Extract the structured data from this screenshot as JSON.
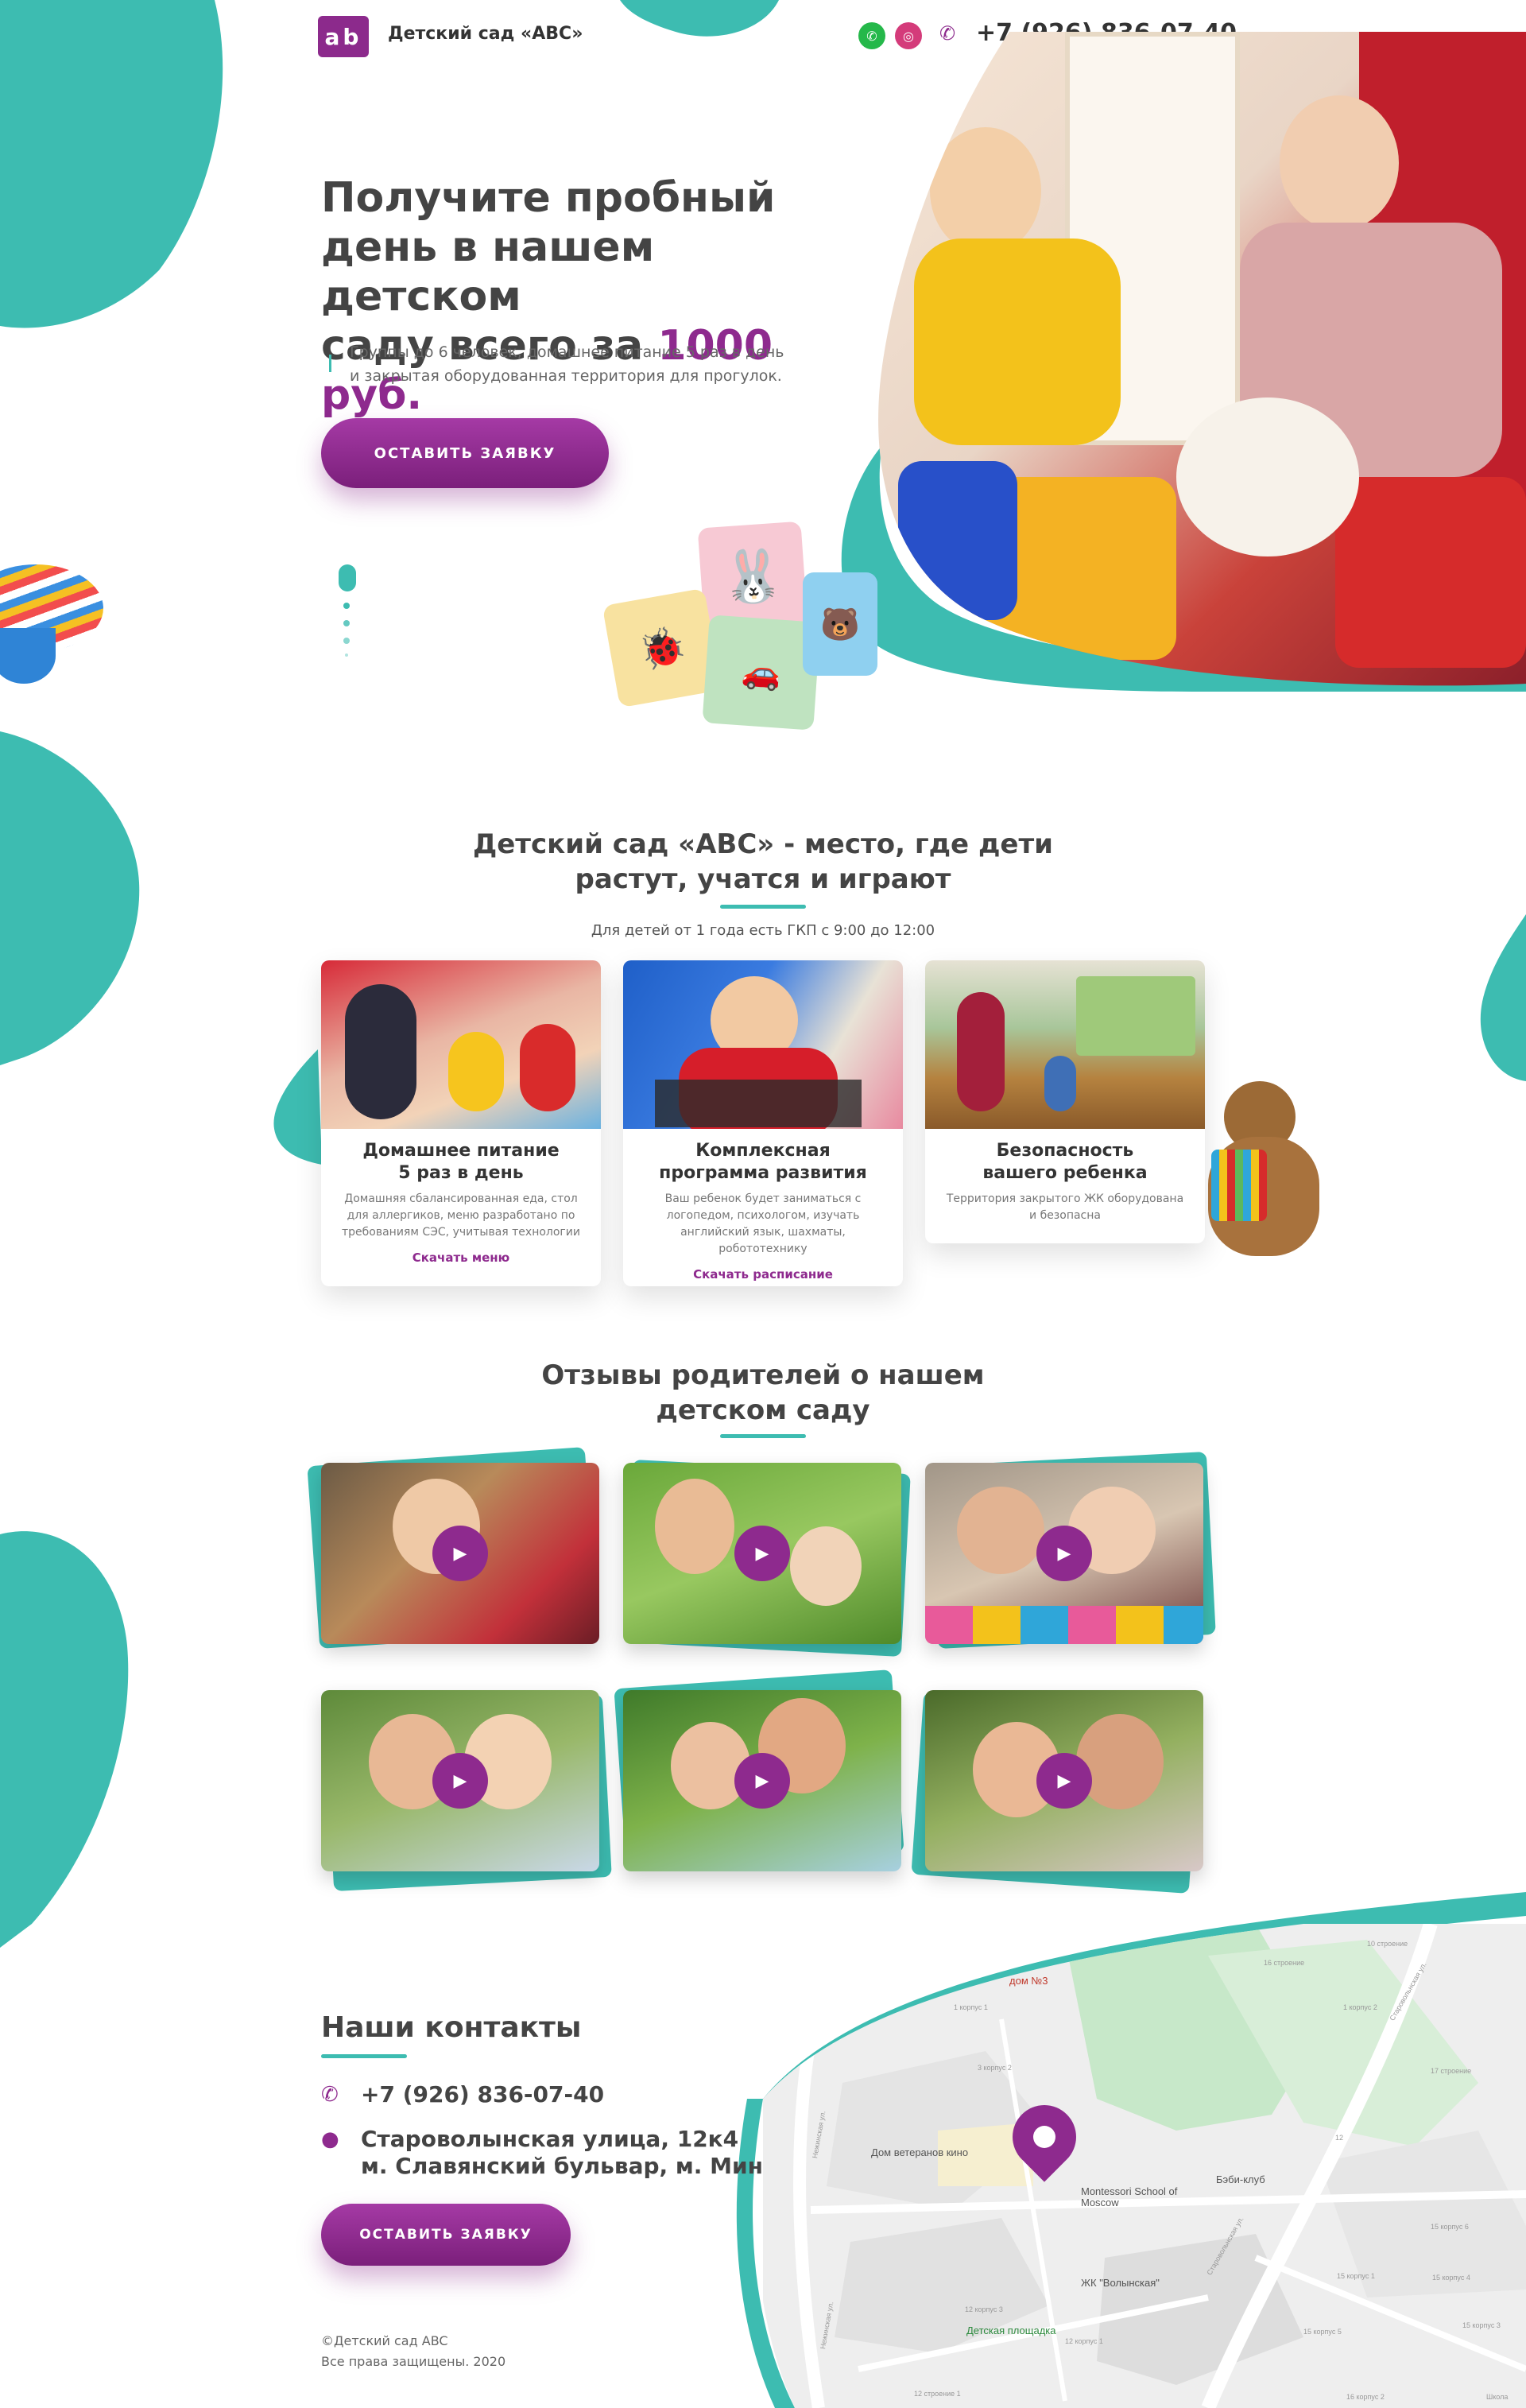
{
  "header": {
    "logo_mark": "ab",
    "site_name": "Детский сад «ABC»",
    "phone": "+7 (926) 836-07-40",
    "whatsapp_icon": "whatsapp-icon",
    "instagram_icon": "instagram-icon"
  },
  "hero": {
    "title_line1": "Получите пробный",
    "title_line2": "день в нашем детском",
    "title_line3_prefix": "саду всего за ",
    "title_price": "1000 руб.",
    "subtitle_line1": "Группы до 6 человек, домашнее питание 5 раз в день",
    "subtitle_line2": "и закрытая оборудованная территория для прогулок.",
    "cta": "ОСТАВИТЬ ЗАЯВКУ"
  },
  "about": {
    "title_line1": "Детский сад «ABC» - место, где дети",
    "title_line2": "растут, учатся и играют",
    "subtitle": "Для детей от 1 года есть ГКП с 9:00 до 12:00",
    "cards": [
      {
        "title_line1": "Домашнее питание",
        "title_line2": "5 раз в день",
        "text": "Домашняя сбалансированная еда, стол для аллергиков, меню разработано по требованиям СЭС, учитывая технологии",
        "link": "Скачать меню"
      },
      {
        "title_line1": "Комплексная",
        "title_line2": "программа развития",
        "text": "Ваш ребенок будет заниматься с логопедом, психологом, изучать английский язык, шахматы, робототехнику",
        "link": "Скачать расписание"
      },
      {
        "title_line1": "Безопасность",
        "title_line2": "вашего ребенка",
        "text": "Территория закрытого ЖК оборудована и безопасна",
        "link": ""
      }
    ]
  },
  "reviews": {
    "title_line1": "Отзывы родителей о нашем",
    "title_line2": "детском саду",
    "play_icon": "play-icon"
  },
  "contacts": {
    "title": "Наши контакты",
    "phone": "+7 (926) 836-07-40",
    "address_line1": "Староволынская улица, 12к4",
    "address_line2": "м. Славянский бульвар, м. Минская",
    "cta": "ОСТАВИТЬ ЗАЯВКУ",
    "copyright_line1": "©Детский сад ABC",
    "copyright_line2": "Все права защищены. 2020"
  },
  "map": {
    "labels": {
      "house": "дом №3",
      "cinema": "Дом ветеранов кино",
      "school": "Montessori School of Moscow",
      "babykl": "Бэби-клуб",
      "zhk": "ЖК \"Волынская\"",
      "playground": "Детская площадка",
      "street1": "Старовольнская ул.",
      "street2": "Старовольнская ул.",
      "street3": "Нежинская ул.",
      "street4": "Нежинская ул.",
      "school2": "Школа",
      "b1": "10 строение",
      "b2": "16 строение",
      "b3": "1 корпус 2",
      "b4": "1 корпус 1",
      "b5": "3 корпус 2",
      "b6": "17 строение",
      "b7": "12",
      "b8": "12 корпус 3",
      "b9": "15 корпус 1",
      "b10": "15 корпус 6",
      "b11": "15 корпус 4",
      "b12": "15 корпус 3",
      "b13": "15 корпус 5",
      "b14": "16 корпус 2",
      "b15": "12 корпус 1",
      "b16": "12 строение 1"
    }
  },
  "colors": {
    "accent_purple": "#8e2a8e",
    "accent_teal": "#3dbcb1",
    "text_dark": "#444444"
  }
}
